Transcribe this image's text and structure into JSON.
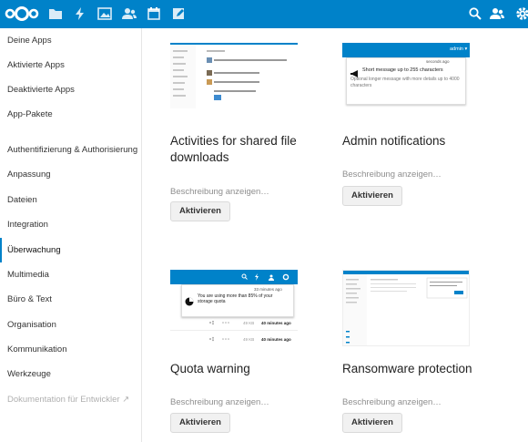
{
  "colors": {
    "brand": "#0082c9",
    "sidebar_active_indicator": "#0082c9"
  },
  "header": {
    "logo": "nextcloud-logo",
    "apps": [
      "files-icon",
      "activity-icon",
      "gallery-icon",
      "contacts-icon",
      "calendar-icon",
      "notes-icon"
    ],
    "right": [
      "search-icon",
      "contacts-menu-icon",
      "settings-icon"
    ]
  },
  "sidebar": {
    "items": [
      {
        "label": "Deine Apps"
      },
      {
        "label": "Aktivierte Apps"
      },
      {
        "label": "Deaktivierte Apps"
      },
      {
        "label": "App-Pakete"
      },
      {
        "label": "Authentifizierung & Authorisierung"
      },
      {
        "label": "Anpassung"
      },
      {
        "label": "Dateien"
      },
      {
        "label": "Integration"
      },
      {
        "label": "Überwachung"
      },
      {
        "label": "Multimedia"
      },
      {
        "label": "Büro & Text"
      },
      {
        "label": "Organisation"
      },
      {
        "label": "Kommunikation"
      },
      {
        "label": "Werkzeuge"
      },
      {
        "label": "Dokumentation für Entwickler ↗"
      }
    ],
    "active_index": 8
  },
  "apps": [
    {
      "title": "Activities for shared file downloads",
      "desc": "Beschreibung anzeigen…",
      "button": "Aktivieren"
    },
    {
      "title": "Admin notifications",
      "desc": "Beschreibung anzeigen…",
      "button": "Aktivieren",
      "preview": {
        "user": "admin ▾",
        "time": "seconds ago",
        "message": "Short message up to 255 characters",
        "detail": "Optional longer message with more details up to 4000 characters"
      }
    },
    {
      "title": "Quota warning",
      "desc": "Beschreibung anzeigen…",
      "button": "Aktivieren",
      "preview": {
        "time": "33 minutes ago",
        "message": "You are using more than 85% of your storage quota",
        "row1_size": "49 KB",
        "row1_time": "40 minutes ago",
        "row2_size": "49 KB",
        "row2_time": "40 minutes ago"
      }
    },
    {
      "title": "Ransomware protection",
      "desc": "Beschreibung anzeigen…",
      "button": "Aktivieren"
    }
  ]
}
